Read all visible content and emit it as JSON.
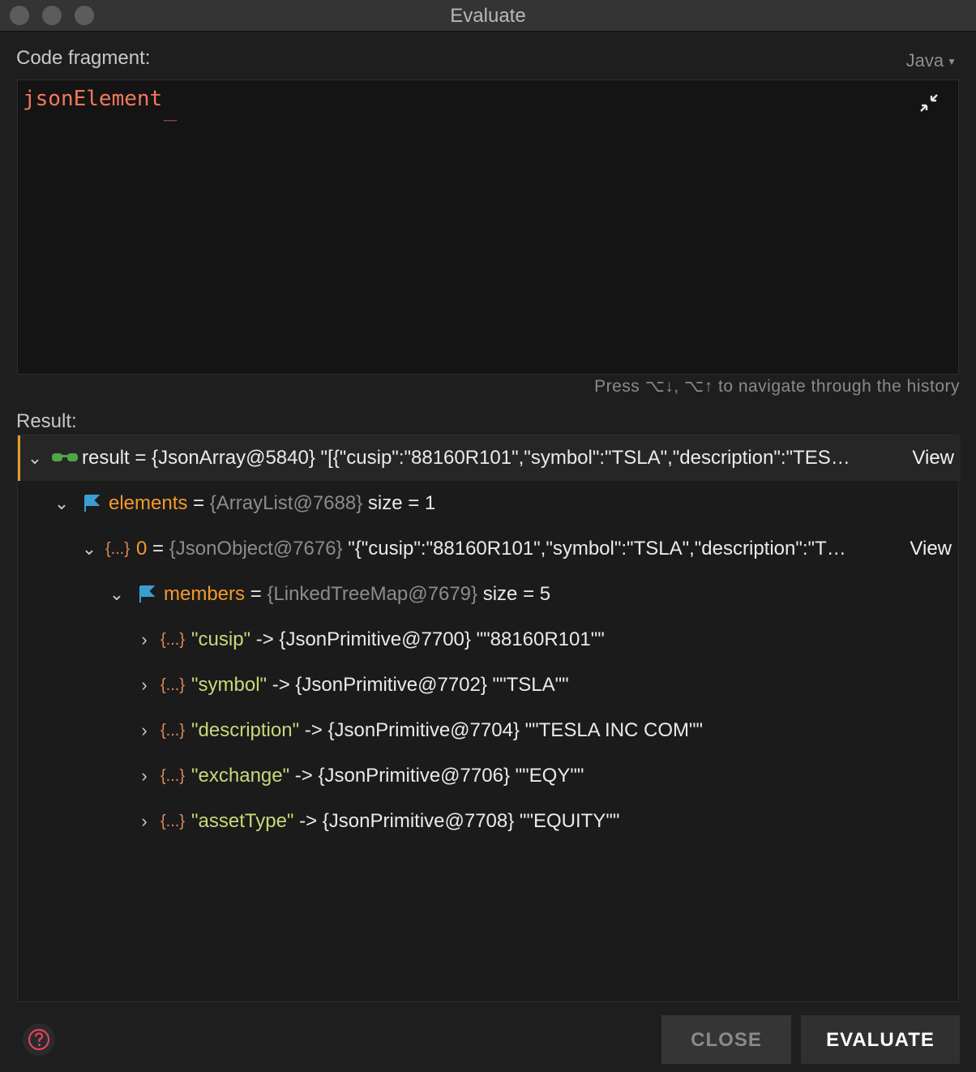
{
  "window": {
    "title": "Evaluate"
  },
  "editor": {
    "label": "Code fragment:",
    "language": "Java",
    "code": "jsonElement",
    "hint": "Press ⌥↓, ⌥↑ to navigate through the history"
  },
  "result": {
    "label": "Result:",
    "rows": [
      {
        "name": "result",
        "eq": " = ",
        "type": "{JsonArray@5840}",
        "value": " \"[{\"cusip\":\"88160R101\",\"symbol\":\"TSLA\",\"description\":\"TES…",
        "view": "View"
      },
      {
        "name": "elements",
        "eq": " = ",
        "type": "{ArrayList@7688}",
        "value": "  size = 1"
      },
      {
        "name": "0",
        "eq": " = ",
        "type": "{JsonObject@7676}",
        "value": " \"{\"cusip\":\"88160R101\",\"symbol\":\"TSLA\",\"description\":\"T…",
        "view": "View"
      },
      {
        "name": "members",
        "eq": " = ",
        "type": "{LinkedTreeMap@7679}",
        "value": "  size = 5"
      },
      {
        "name": "\"cusip\"",
        "arrow": " -> ",
        "type": "{JsonPrimitive@7700}",
        "value": " \"\"88160R101\"\""
      },
      {
        "name": "\"symbol\"",
        "arrow": " -> ",
        "type": "{JsonPrimitive@7702}",
        "value": " \"\"TSLA\"\""
      },
      {
        "name": "\"description\"",
        "arrow": " -> ",
        "type": "{JsonPrimitive@7704}",
        "value": " \"\"TESLA INC COM\"\""
      },
      {
        "name": "\"exchange\"",
        "arrow": " -> ",
        "type": "{JsonPrimitive@7706}",
        "value": " \"\"EQY\"\""
      },
      {
        "name": "\"assetType\"",
        "arrow": " -> ",
        "type": "{JsonPrimitive@7708}",
        "value": " \"\"EQUITY\"\""
      }
    ]
  },
  "object_icon": "{...}",
  "buttons": {
    "close": "CLOSE",
    "evaluate": "EVALUATE"
  },
  "icons": {
    "watch": "glasses-icon",
    "field": "flag-icon",
    "object": "braces-icon",
    "help": "help-icon",
    "collapse": "collapse-icon"
  },
  "colors": {
    "accent": "#e79a2b",
    "keyword": "#f39a2c",
    "string_key": "#c8d87a",
    "code": "#f2785c"
  }
}
